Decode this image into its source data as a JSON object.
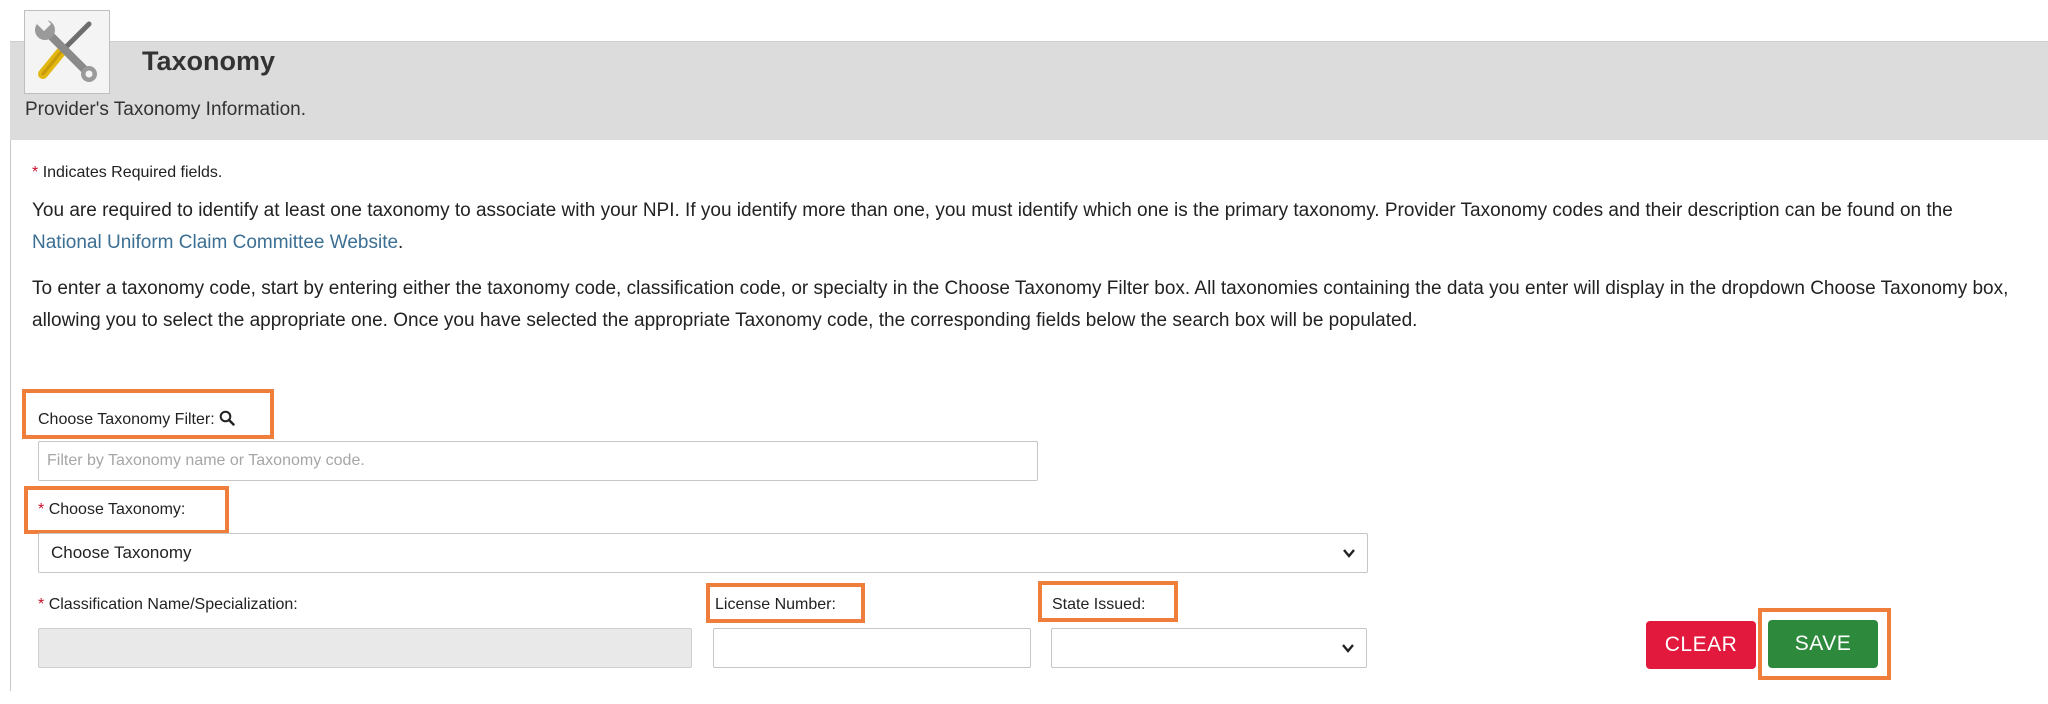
{
  "header": {
    "title": "Taxonomy",
    "subtitle": "Provider's Taxonomy Information."
  },
  "intro": {
    "required_note": "Indicates Required fields.",
    "paragraph1": "You are required to identify at least one taxonomy to associate with your NPI. If you identify more than one, you must identify which one is the primary taxonomy. Provider Taxonomy codes and their description can be found on the",
    "link_text": "National Uniform Claim Committee Website",
    "paragraph1_end": ".",
    "paragraph2": "To enter a taxonomy code, start by entering either the taxonomy code, classification code, or specialty in the Choose Taxonomy Filter box. All taxonomies containing the data you enter will display in the dropdown Choose Taxonomy box, allowing you to select the appropriate one. Once you have selected the appropriate Taxonomy code, the corresponding fields below the search box will be populated."
  },
  "form": {
    "required_marker": "*",
    "filter_label": "Choose Taxonomy Filter:",
    "filter_placeholder": "Filter by Taxonomy name or Taxonomy code.",
    "filter_value": "",
    "taxonomy_label": "Choose Taxonomy:",
    "taxonomy_selected": "Choose Taxonomy",
    "classification_label": "Classification Name/Specialization:",
    "classification_value": "",
    "license_label": "License Number:",
    "license_value": "",
    "state_label": "State Issued:",
    "state_selected": ""
  },
  "actions": {
    "clear_label": "CLEAR",
    "save_label": "SAVE"
  },
  "colors": {
    "header_band": "#dcdcdc",
    "required": "#c8102e",
    "link": "#3b6f93",
    "highlight": "#ef7d3c",
    "clear_button": "#e2183c",
    "save_button": "#2d8a3c"
  },
  "icons": {
    "logo": "tools-icon",
    "filter": "search-icon",
    "dropdown": "chevron-down-icon"
  }
}
